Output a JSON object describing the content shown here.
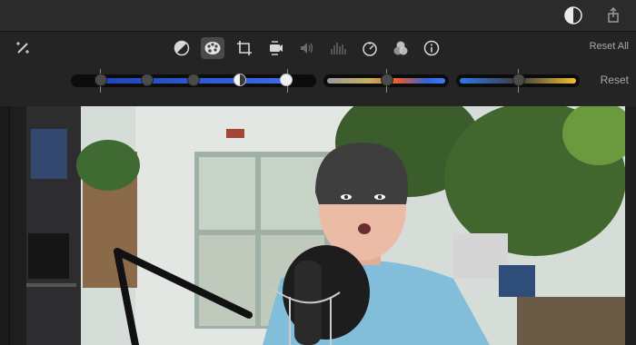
{
  "toolbar": {
    "reset_all_label": "Reset All",
    "reset_label": "Reset",
    "tools": [
      {
        "name": "color-balance-icon",
        "active": false
      },
      {
        "name": "color-correction-icon",
        "active": true
      },
      {
        "name": "crop-icon",
        "active": false
      },
      {
        "name": "stabilization-icon",
        "active": false
      },
      {
        "name": "volume-icon",
        "active": false
      },
      {
        "name": "noise-reduction-icon",
        "active": false
      },
      {
        "name": "speed-icon",
        "active": false
      },
      {
        "name": "clip-filter-icon",
        "active": false
      },
      {
        "name": "info-icon",
        "active": false
      }
    ]
  },
  "sliders": {
    "multi_knob_levels": [
      0.0,
      0.22,
      0.44,
      0.66,
      1.0
    ],
    "saturation_level": 0.5,
    "temperature_level": 0.5
  },
  "colors": {
    "accent_blue": "#2f5fd6"
  }
}
